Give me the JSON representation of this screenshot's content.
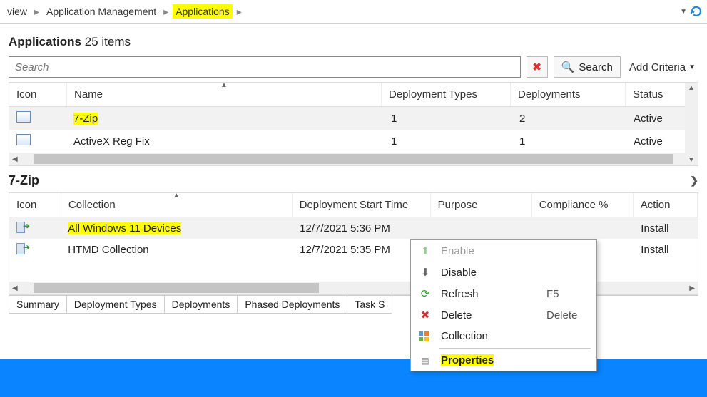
{
  "breadcrumb": {
    "item1": "view",
    "item2": "Application Management",
    "item3": "Applications"
  },
  "apps": {
    "title_bold": "Applications",
    "title_rest": "25 items",
    "search_placeholder": "Search",
    "search_btn": "Search",
    "add_criteria": "Add Criteria",
    "cols": {
      "icon": "Icon",
      "name": "Name",
      "dt": "Deployment Types",
      "dep": "Deployments",
      "stat": "Status"
    },
    "rows": [
      {
        "name": "7-Zip",
        "dt": "1",
        "dep": "2",
        "stat": "Active"
      },
      {
        "name": "ActiveX Reg Fix",
        "dt": "1",
        "dep": "1",
        "stat": "Active"
      }
    ]
  },
  "detail": {
    "title": "7-Zip",
    "cols": {
      "icon": "Icon",
      "coll": "Collection",
      "start": "Deployment Start Time",
      "purp": "Purpose",
      "comp": "Compliance %",
      "act": "Action"
    },
    "rows": [
      {
        "coll": "All Windows 11 Devices",
        "start": "12/7/2021 5:36 PM",
        "purp": "",
        "comp": "",
        "act": "Install"
      },
      {
        "coll": "HTMD Collection",
        "start": "12/7/2021 5:35 PM",
        "purp": "",
        "comp": "",
        "act": "Install"
      }
    ]
  },
  "tabs": {
    "t1": "Summary",
    "t2": "Deployment Types",
    "t3": "Deployments",
    "t4": "Phased Deployments",
    "t5": "Task S"
  },
  "menu": {
    "enable": "Enable",
    "disable": "Disable",
    "refresh": "Refresh",
    "refresh_sc": "F5",
    "delete": "Delete",
    "delete_sc": "Delete",
    "collection": "Collection",
    "properties": "Properties"
  }
}
